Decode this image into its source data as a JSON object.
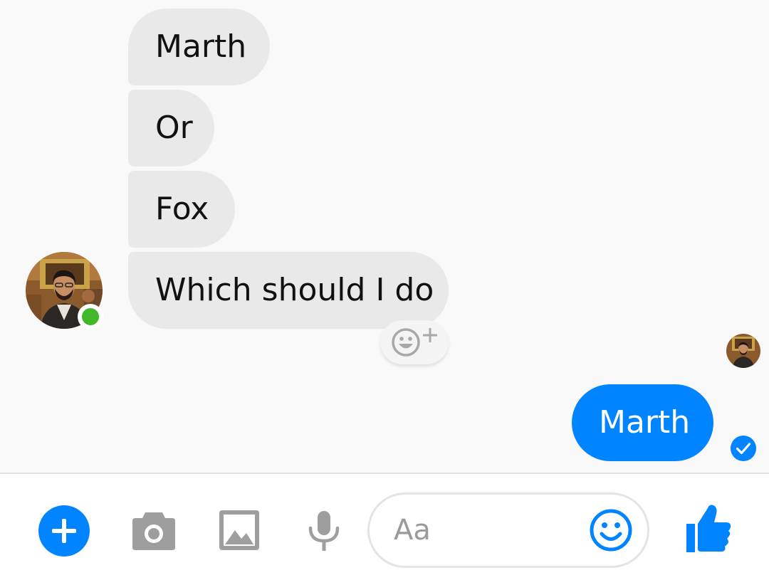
{
  "conversation": {
    "incoming": [
      {
        "text": "Marth"
      },
      {
        "text": "Or"
      },
      {
        "text": "Fox"
      },
      {
        "text": "Which should I do"
      }
    ],
    "outgoing": [
      {
        "text": "Marth"
      }
    ],
    "contact_status": "online"
  },
  "composer": {
    "placeholder": "Aa",
    "value": ""
  },
  "icons": {
    "add": "plus-circle-icon",
    "camera": "camera-icon",
    "gallery": "image-icon",
    "voice": "microphone-icon",
    "emoji": "smiley-icon",
    "like": "thumbs-up-icon",
    "react": "add-reaction-icon",
    "delivered": "check-circle-icon"
  },
  "colors": {
    "accent": "#0084ff",
    "incoming_bubble": "#e9e9e9",
    "presence": "#42b72a",
    "icon_gray": "#9e9e9e"
  }
}
